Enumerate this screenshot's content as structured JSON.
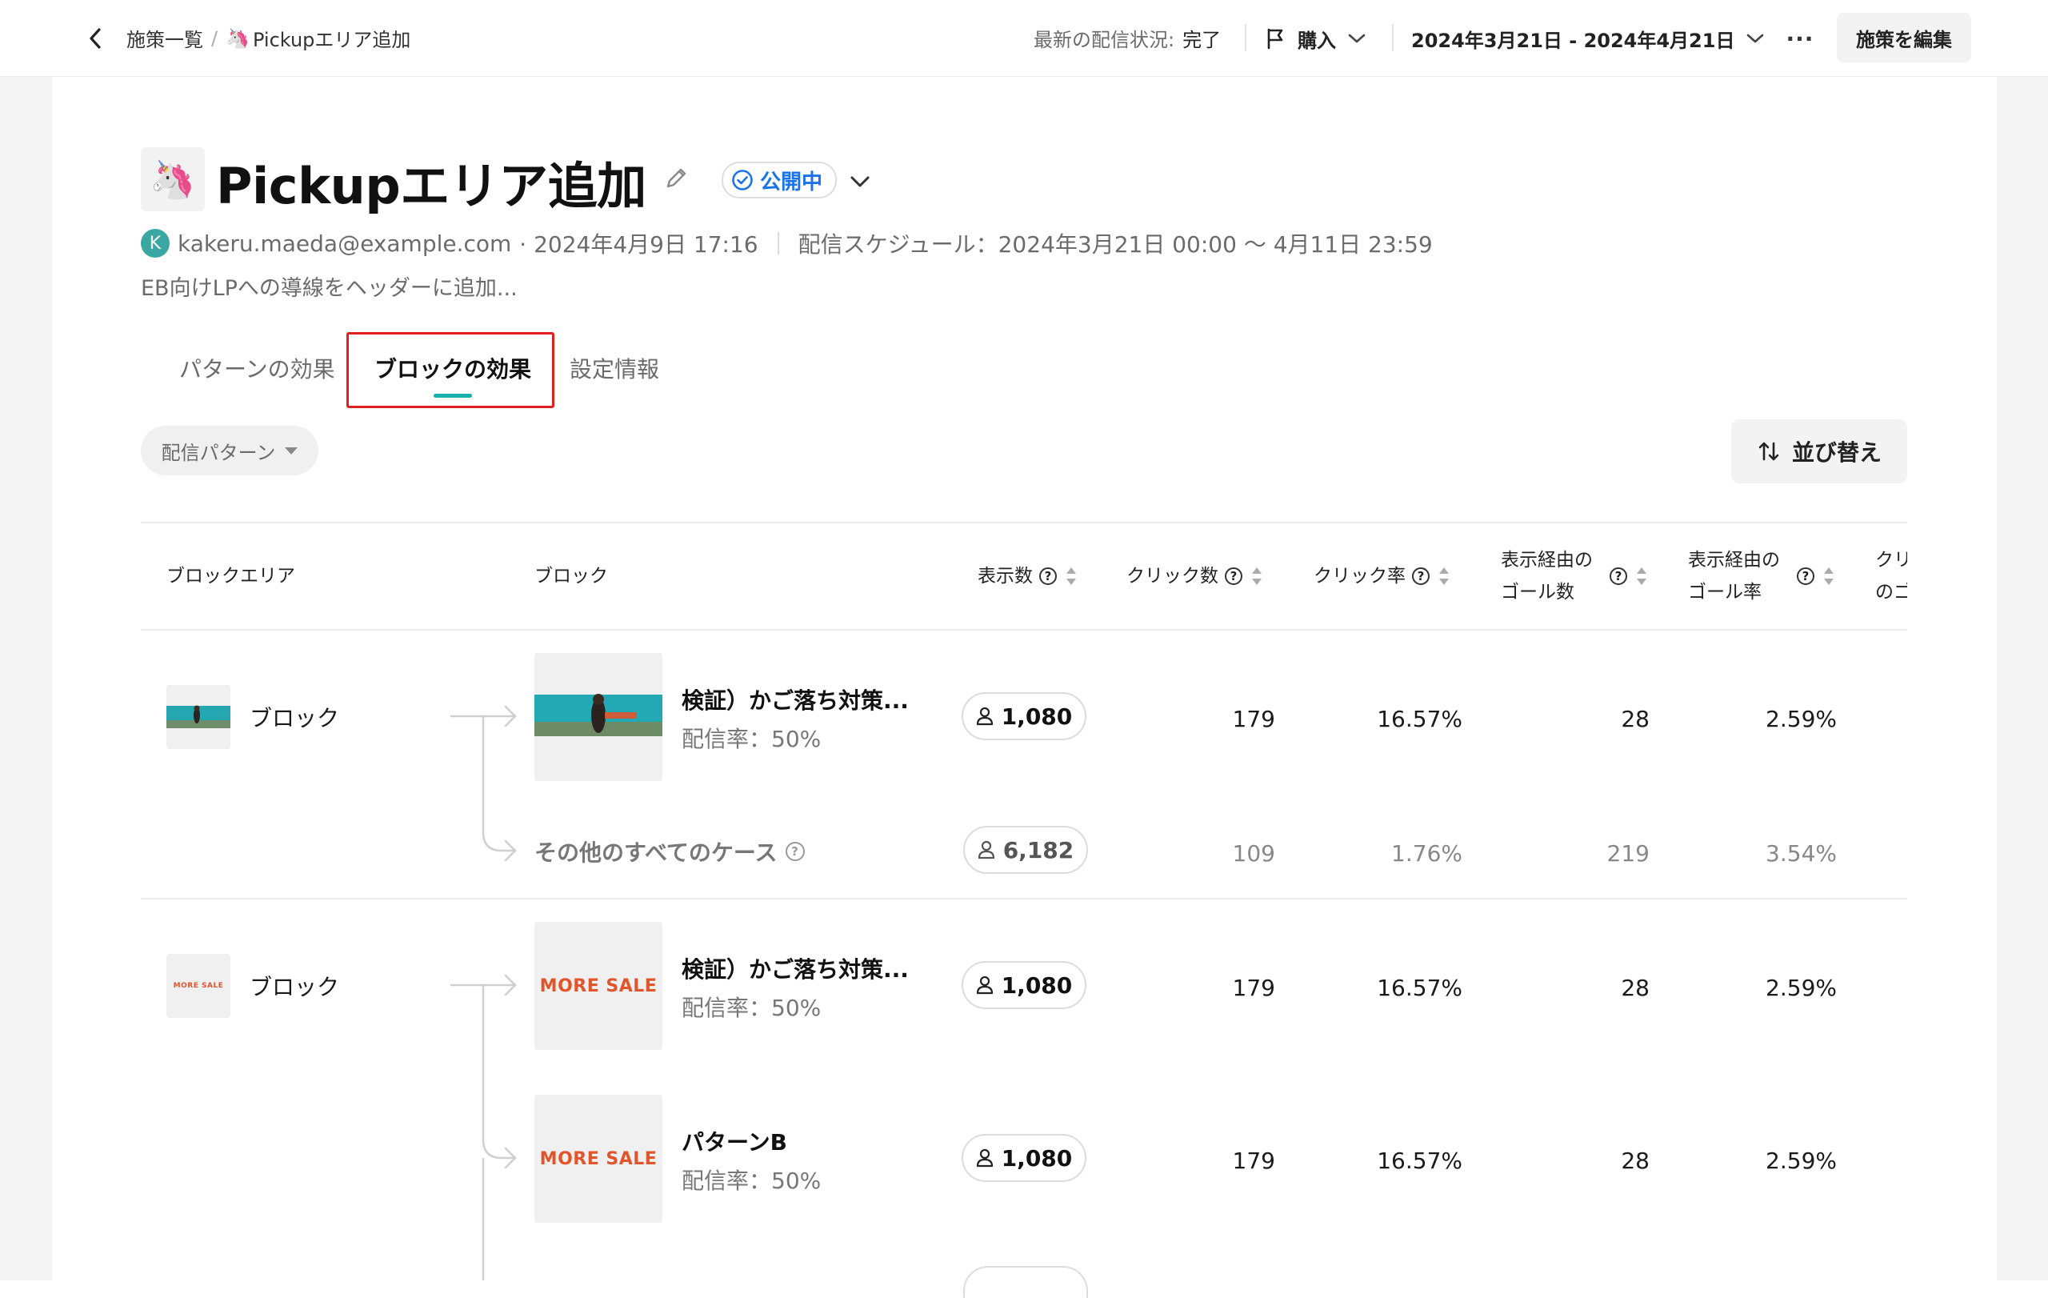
{
  "topbar": {
    "breadcrumb_root": "施策一覧",
    "breadcrumb_sep": "/",
    "breadcrumb_current": "Pickupエリア追加",
    "breadcrumb_emoji": "🦄",
    "status_label": "最新の配信状況:",
    "status_value": "完了",
    "goal_label": "購入",
    "date_range": "2024年3月21日 - 2024年4月21日",
    "more_label": "···",
    "edit_button": "施策を編集"
  },
  "header": {
    "emoji": "🦄",
    "title": "Pickupエリア追加",
    "status_badge": "公開中",
    "avatar_initial": "K",
    "author": "kakeru.maeda@example.com",
    "created_at": "· 2024年4月9日 17:16",
    "schedule": "配信スケジュール：2024年3月21日 00:00 〜 4月11日 23:59",
    "description": "EB向けLPへの導線をヘッダーに追加..."
  },
  "tabs": [
    {
      "label": "パターンの効果",
      "active": false
    },
    {
      "label": "ブロックの効果",
      "active": true
    },
    {
      "label": "設定情報",
      "active": false
    }
  ],
  "filter": {
    "label": "配信パターン"
  },
  "sort_button": "並び替え",
  "table": {
    "headers": {
      "area": "ブロックエリア",
      "block": "ブロック",
      "impressions": "表示数",
      "clicks": "クリック数",
      "ctr": "クリック率",
      "goal_count_1": "表示経由の",
      "goal_count_2": "ゴール数",
      "goal_rate_1": "表示経由の",
      "goal_rate_2": "ゴール率",
      "cut_1": "クリ",
      "cut_2": "のゴ"
    },
    "groups": [
      {
        "area_label": "ブロック",
        "rows": [
          {
            "title": "検証）かご落ち対策...",
            "rate": "配信率：50%",
            "users": "1,080",
            "impressions": "179",
            "ctr": "16.57%",
            "goals": "28",
            "goal_rate": "2.59%"
          },
          {
            "title": "その他のすべてのケース",
            "users": "6,182",
            "impressions": "109",
            "ctr": "1.76%",
            "goals": "219",
            "goal_rate": "3.54%"
          }
        ]
      },
      {
        "area_label": "ブロック",
        "thumb_text": "MORE SALE",
        "rows": [
          {
            "title": "検証）かご落ち対策...",
            "rate": "配信率：50%",
            "thumb_text": "MORE SALE",
            "users": "1,080",
            "impressions": "179",
            "ctr": "16.57%",
            "goals": "28",
            "goal_rate": "2.59%"
          },
          {
            "title": "パターンB",
            "rate": "配信率：50%",
            "thumb_text": "MORE SALE",
            "users": "1,080",
            "impressions": "179",
            "ctr": "16.57%",
            "goals": "28",
            "goal_rate": "2.59%"
          }
        ]
      }
    ]
  },
  "colors": {
    "accent_teal": "#1ab0ac",
    "highlight_red": "#e0201e",
    "badge_blue": "#1a73e8",
    "sale_orange": "#e2542b"
  }
}
